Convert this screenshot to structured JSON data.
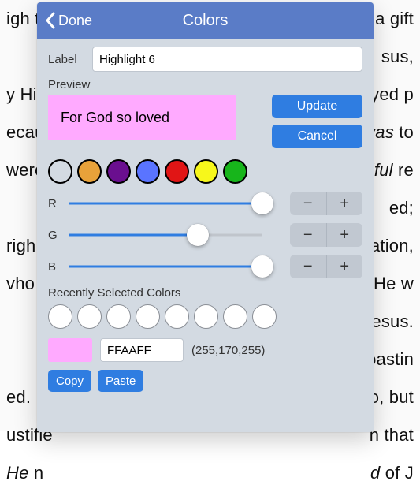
{
  "background": {
    "lines": [
      {
        "l": "igh the redemption that",
        "r": "being justified as a gift"
      },
      {
        "l": "",
        "r": "sus,"
      },
      {
        "l": "y His",
        "r": "ayed p"
      },
      {
        "l": "ecau",
        "r": "vas to"
      },
      {
        "l": "were",
        "r": "ciful re"
      },
      {
        "l": "",
        "r": "ed;"
      },
      {
        "l": "righ",
        "r": "ation,"
      },
      {
        "l": "vho h",
        "r": "t He w"
      },
      {
        "l": "",
        "r": "esus."
      },
      {
        "l": "",
        "r": "oastin"
      },
      {
        "l": "ed. By",
        "r": "lo, but"
      },
      {
        "l": "ustifie",
        "r": "n that"
      },
      {
        "l": "He n",
        "r": "d of J"
      }
    ]
  },
  "header": {
    "done": "Done",
    "title": "Colors"
  },
  "label_field": {
    "caption": "Label",
    "value": "Highlight 6"
  },
  "preview": {
    "caption": "Preview",
    "text": "For God so loved",
    "bg": "#ffaaff"
  },
  "actions": {
    "update": "Update",
    "cancel": "Cancel"
  },
  "palette": [
    {
      "name": "none",
      "color": "hollow"
    },
    {
      "name": "orange",
      "color": "#e8a23a"
    },
    {
      "name": "purple",
      "color": "#6a0f8f"
    },
    {
      "name": "blue",
      "color": "#5a74ff"
    },
    {
      "name": "red",
      "color": "#e11515"
    },
    {
      "name": "yellow",
      "color": "#f7f71b"
    },
    {
      "name": "green",
      "color": "#17b51b"
    }
  ],
  "sliders": {
    "r": {
      "label": "R",
      "value": 255,
      "max": 255
    },
    "g": {
      "label": "G",
      "value": 170,
      "max": 255
    },
    "b": {
      "label": "B",
      "value": 255,
      "max": 255
    }
  },
  "recent": {
    "caption": "Recently Selected Colors",
    "count": 8
  },
  "current": {
    "hex": "FFAAFF",
    "rgb": "(255,170,255)",
    "swatch": "#ffaaff"
  },
  "clipboard": {
    "copy": "Copy",
    "paste": "Paste"
  }
}
